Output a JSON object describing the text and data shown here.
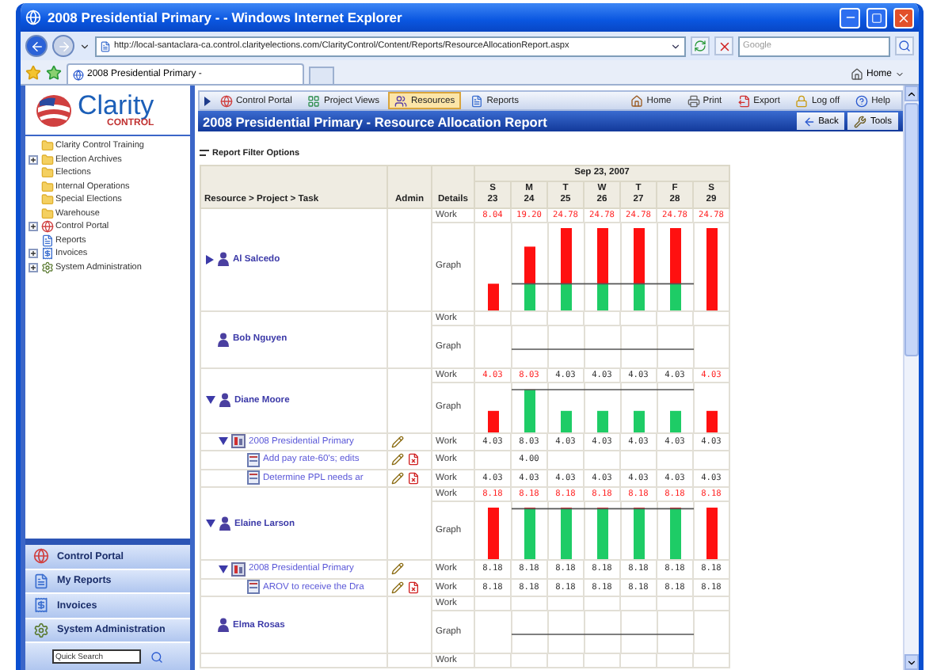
{
  "browser": {
    "title": "2008 Presidential Primary - - Windows Internet Explorer",
    "address": "http://local-santaclara-ca.control.clarityelections.com/ClarityControl/Content/Reports/ResourceAllocationReport.aspx",
    "search_placeholder": "Google",
    "tab": "2008 Presidential Primary -",
    "home": "Home"
  },
  "logo": {
    "name": "Clarity",
    "tagline": "CONTROL"
  },
  "tree": [
    {
      "label": "Clarity Control Training"
    },
    {
      "label": "Election Archives",
      "expanded": false
    },
    {
      "label": "Elections"
    },
    {
      "label": "Internal Operations"
    },
    {
      "label": "Special Elections"
    },
    {
      "label": "Warehouse"
    },
    {
      "label": "Control Portal",
      "expanded": false
    },
    {
      "label": "Reports"
    },
    {
      "label": "Invoices",
      "expanded": false
    },
    {
      "label": "System Administration",
      "expanded": false
    }
  ],
  "nav": [
    {
      "label": "Control Portal"
    },
    {
      "label": "My Reports"
    },
    {
      "label": "Invoices"
    },
    {
      "label": "System Administration"
    }
  ],
  "quick_search": {
    "placeholder": "Quick Search"
  },
  "toolbar": {
    "left": [
      {
        "label": "Control Portal",
        "selected": false
      },
      {
        "label": "Project Views",
        "selected": false
      },
      {
        "label": "Resources",
        "selected": true
      },
      {
        "label": "Reports",
        "selected": false
      }
    ],
    "right": [
      {
        "label": "Home"
      },
      {
        "label": "Print"
      },
      {
        "label": "Export"
      },
      {
        "label": "Log off"
      },
      {
        "label": "Help"
      }
    ]
  },
  "report": {
    "title": "2008 Presidential Primary - Resource Allocation Report",
    "actions": [
      {
        "label": "Back"
      },
      {
        "label": "Tools"
      }
    ],
    "filter": "Report Filter Options",
    "columns": {
      "resource": "Resource > Project > Task",
      "admin": "Admin",
      "details": "Details"
    },
    "week": "Sep 23, 2007",
    "days": [
      {
        "dow": "S",
        "date": "23",
        "weekend": true
      },
      {
        "dow": "M",
        "date": "24",
        "weekend": false
      },
      {
        "dow": "T",
        "date": "25",
        "weekend": false
      },
      {
        "dow": "W",
        "date": "26",
        "weekend": false
      },
      {
        "dow": "T",
        "date": "27",
        "weekend": false
      },
      {
        "dow": "F",
        "date": "28",
        "weekend": false
      },
      {
        "dow": "S",
        "date": "29",
        "weekend": true
      }
    ],
    "resources": [
      {
        "name": "Al Salcedo",
        "expanded": false,
        "work_label": "Work",
        "graph_label": "Graph",
        "work": [
          {
            "value": "8.04",
            "over": true
          },
          {
            "value": "19.20",
            "over": true
          },
          {
            "value": "24.78",
            "over": true
          },
          {
            "value": "24.78",
            "over": true
          },
          {
            "value": "24.78",
            "over": true
          },
          {
            "value": "24.78",
            "over": true
          },
          {
            "value": "24.78",
            "over": true
          }
        ]
      },
      {
        "name": "Bob Nguyen",
        "work_label": "Work",
        "graph_label": "Graph"
      },
      {
        "name": "Diane Moore",
        "expanded": true,
        "work_label": "Work",
        "graph_label": "Graph",
        "work": [
          {
            "value": "4.03",
            "over": true
          },
          {
            "value": "8.03",
            "over": true
          },
          {
            "value": "4.03",
            "over": false
          },
          {
            "value": "4.03",
            "over": false
          },
          {
            "value": "4.03",
            "over": false
          },
          {
            "value": "4.03",
            "over": false
          },
          {
            "value": "4.03",
            "over": true
          }
        ],
        "children": [
          {
            "kind": "project",
            "name": "2008 Presidential Primary",
            "expanded": true,
            "details": "Work",
            "work": [
              {
                "value": "4.03",
                "over": false
              },
              {
                "value": "8.03",
                "over": false
              },
              {
                "value": "4.03",
                "over": false
              },
              {
                "value": "4.03",
                "over": false
              },
              {
                "value": "4.03",
                "over": false
              },
              {
                "value": "4.03",
                "over": false
              },
              {
                "value": "4.03",
                "over": false
              }
            ]
          },
          {
            "kind": "task",
            "name": "Add pay rate-60's; edits",
            "details": "Work",
            "work": [
              {
                "empty": true
              },
              {
                "value": "4.00",
                "over": false
              },
              {
                "empty": true
              },
              {
                "empty": true
              },
              {
                "empty": true
              },
              {
                "empty": true
              },
              {
                "empty": true
              }
            ]
          },
          {
            "kind": "task",
            "name": "Determine PPL needs ar",
            "details": "Work",
            "work": [
              {
                "value": "4.03",
                "over": false
              },
              {
                "value": "4.03",
                "over": false
              },
              {
                "value": "4.03",
                "over": false
              },
              {
                "value": "4.03",
                "over": false
              },
              {
                "value": "4.03",
                "over": false
              },
              {
                "value": "4.03",
                "over": false
              },
              {
                "value": "4.03",
                "over": false
              }
            ]
          }
        ]
      },
      {
        "name": "Elaine Larson",
        "expanded": true,
        "work_label": "Work",
        "graph_label": "Graph",
        "work": [
          {
            "value": "8.18",
            "over": true
          },
          {
            "value": "8.18",
            "over": true
          },
          {
            "value": "8.18",
            "over": true
          },
          {
            "value": "8.18",
            "over": true
          },
          {
            "value": "8.18",
            "over": true
          },
          {
            "value": "8.18",
            "over": true
          },
          {
            "value": "8.18",
            "over": true
          }
        ],
        "children": [
          {
            "kind": "project",
            "name": "2008 Presidential Primary",
            "expanded": true,
            "details": "Work",
            "work": [
              {
                "value": "8.18",
                "over": false
              },
              {
                "value": "8.18",
                "over": false
              },
              {
                "value": "8.18",
                "over": false
              },
              {
                "value": "8.18",
                "over": false
              },
              {
                "value": "8.18",
                "over": false
              },
              {
                "value": "8.18",
                "over": false
              },
              {
                "value": "8.18",
                "over": false
              }
            ]
          },
          {
            "kind": "task",
            "name": "AROV to receive the Dra",
            "details": "Work",
            "work": [
              {
                "value": "8.18",
                "over": false
              },
              {
                "value": "8.18",
                "over": false
              },
              {
                "value": "8.18",
                "over": false
              },
              {
                "value": "8.18",
                "over": false
              },
              {
                "value": "8.18",
                "over": false
              },
              {
                "value": "8.18",
                "over": false
              },
              {
                "value": "8.18",
                "over": false
              }
            ]
          }
        ]
      },
      {
        "name": "Elma Rosas",
        "work_label": "Work",
        "graph_label": "Graph"
      }
    ],
    "trailing_row": {
      "details": "Work"
    }
  }
}
